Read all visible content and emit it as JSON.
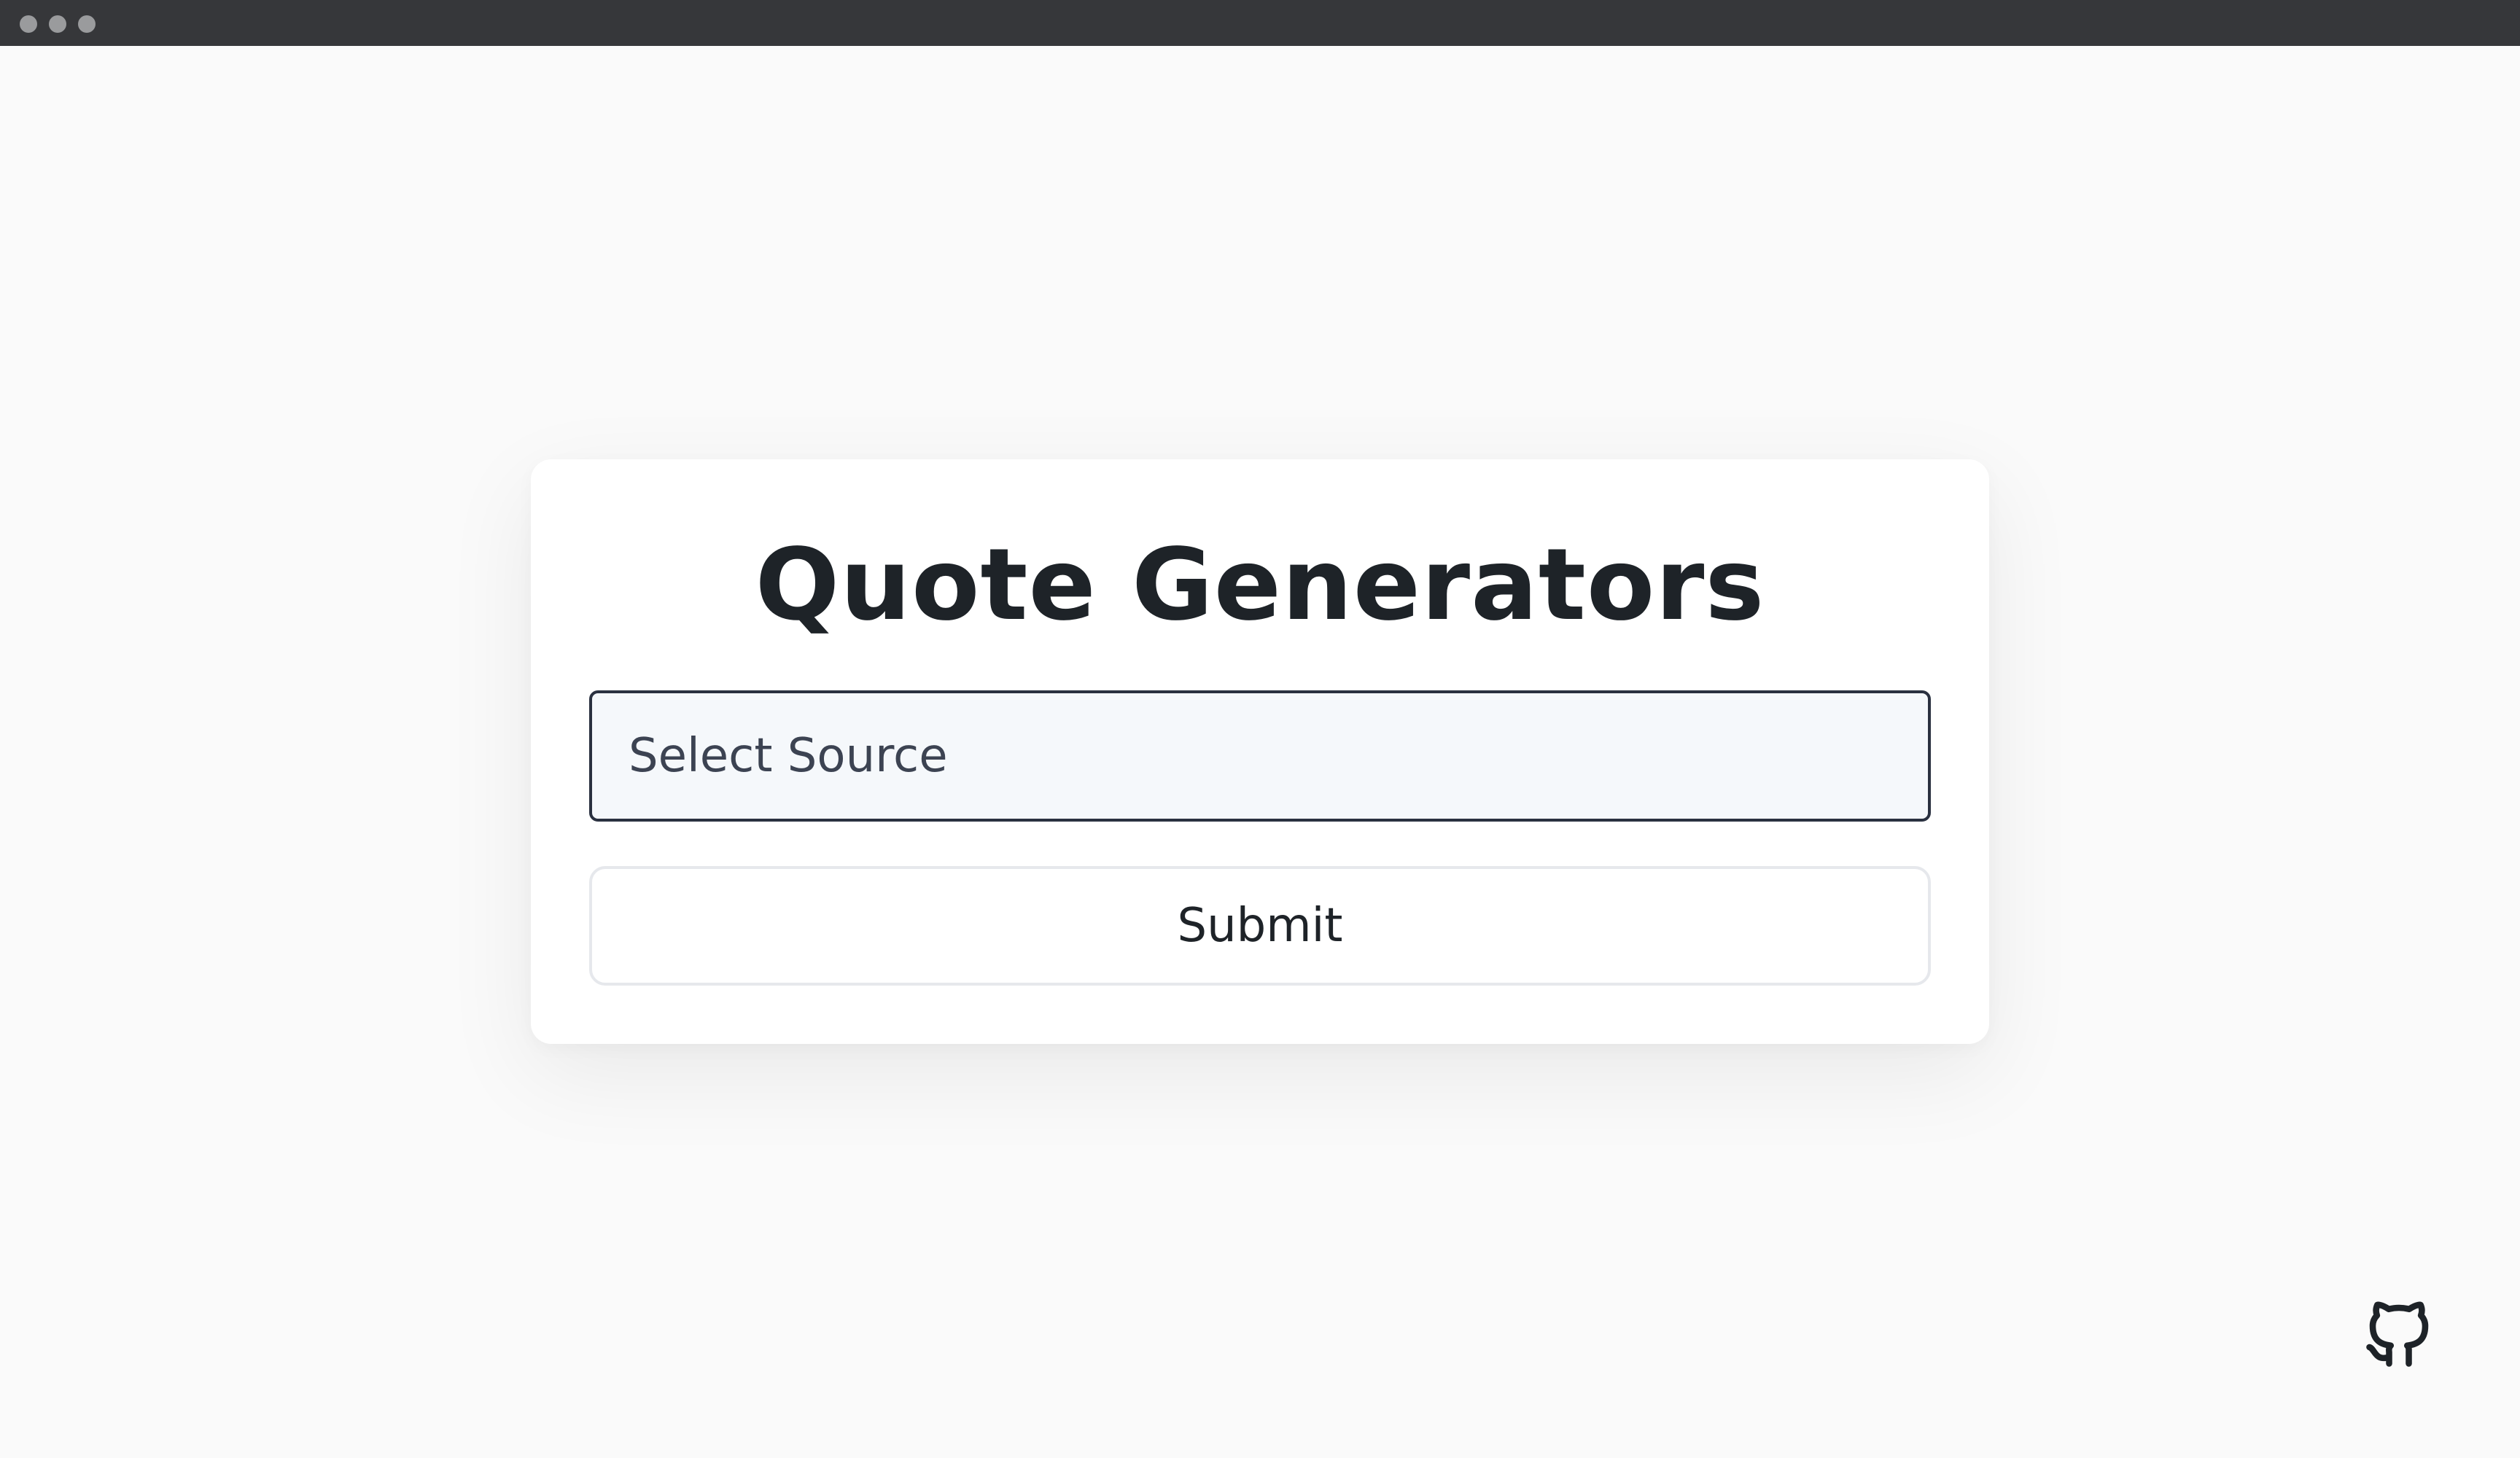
{
  "window": {
    "traffic_lights": [
      "close",
      "minimize",
      "zoom"
    ]
  },
  "card": {
    "title": "Quote Generators",
    "select": {
      "placeholder": "Select Source"
    },
    "submit_label": "Submit"
  },
  "footer": {
    "icon": "github-icon"
  },
  "colors": {
    "background": "#fafafa",
    "titlebar": "#36373a",
    "card": "#ffffff",
    "text": "#1e2328",
    "select_border": "#2a3140",
    "select_bg": "#f5f8fb",
    "button_border": "#e6e8ec"
  }
}
